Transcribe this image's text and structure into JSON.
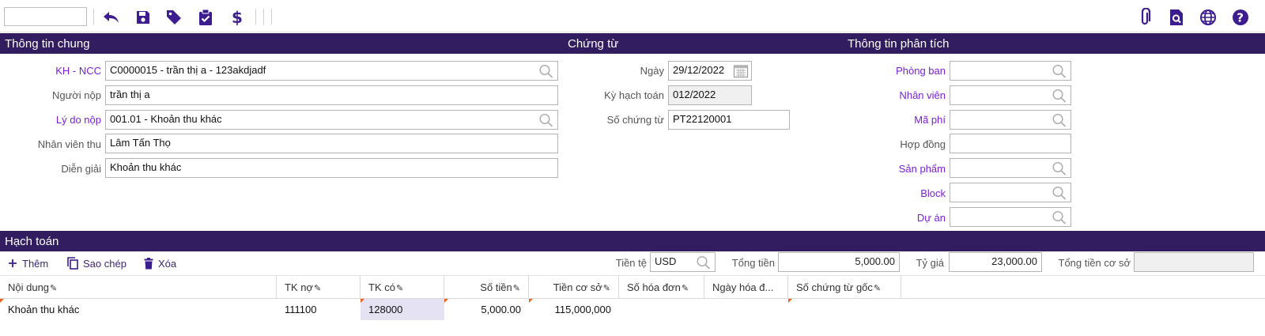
{
  "colors": {
    "accent": "#321d61",
    "link": "#7a1fd6",
    "icon": "#3d1c8f",
    "marker": "#e8611a"
  },
  "toolbar": {
    "search_value": "",
    "left_icons": [
      "undo-icon",
      "save-icon",
      "tag-icon",
      "clipboard-check-icon",
      "dollar-icon"
    ],
    "right_icons": [
      "paperclip-icon",
      "document-search-icon",
      "globe-icon",
      "help-icon"
    ]
  },
  "sections": {
    "general": "Thông tin chung",
    "voucher": "Chứng từ",
    "analysis": "Thông tin phân tích",
    "accounting": "Hạch toán"
  },
  "general": {
    "customer": {
      "label": "KH - NCC",
      "value": "C0000015 - trần thị a - 123akdjadf"
    },
    "payer": {
      "label": "Người nộp",
      "value": "trần thị a"
    },
    "reason": {
      "label": "Lý do nộp",
      "value": "001.01 - Khoản thu khác"
    },
    "collector": {
      "label": "Nhân viên thu",
      "value": "Lâm Tấn Thọ"
    },
    "description": {
      "label": "Diễn giải",
      "value": "Khoản thu khác"
    }
  },
  "voucher": {
    "date": {
      "label": "Ngày",
      "value": "29/12/2022"
    },
    "period": {
      "label": "Kỳ hạch toán",
      "value": "012/2022"
    },
    "number": {
      "label": "Số chứng từ",
      "value": "PT22120001"
    }
  },
  "analysis": {
    "department": {
      "label": "Phòng ban",
      "value": ""
    },
    "employee": {
      "label": "Nhân viên",
      "value": ""
    },
    "fee_code": {
      "label": "Mã phí",
      "value": ""
    },
    "contract": {
      "label": "Hợp đồng",
      "value": ""
    },
    "product": {
      "label": "Sản phẩm",
      "value": ""
    },
    "block": {
      "label": "Block",
      "value": ""
    },
    "project": {
      "label": "Dự án",
      "value": ""
    }
  },
  "actions": {
    "add": "Thêm",
    "copy": "Sao chép",
    "delete": "Xóa"
  },
  "summary": {
    "currency": {
      "label": "Tiền tệ",
      "value": "USD"
    },
    "total": {
      "label": "Tổng tiền",
      "value": "5,000.00"
    },
    "rate": {
      "label": "Tỷ giá",
      "value": "23,000.00"
    },
    "base_total": {
      "label": "Tổng tiền cơ sở",
      "value": ""
    }
  },
  "grid": {
    "columns": [
      "Nội dung",
      "TK nợ",
      "TK có",
      "Số tiền",
      "Tiền cơ sở",
      "Số hóa đơn",
      "Ngày hóa đ...",
      "Số chứng từ gốc"
    ],
    "rows": [
      {
        "content": "Khoản thu khác",
        "debit": "111100",
        "credit": "128000",
        "amount": "5,000.00",
        "base_amount": "115,000,000",
        "invoice_no": "",
        "invoice_date": "",
        "source_doc": ""
      }
    ]
  }
}
